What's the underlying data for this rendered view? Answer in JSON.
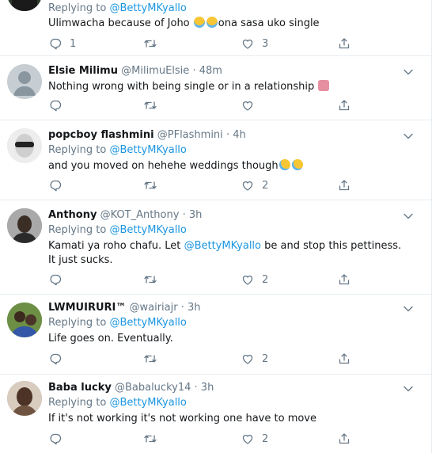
{
  "tweets": [
    {
      "name": "",
      "handle": "",
      "time": "",
      "replying_prefix": "Replying to",
      "replying_to": "@BettyMKyallo",
      "text_before": "Ulimwacha because of Joho",
      "text_after": "ona sasa uko single",
      "emojis": [
        "tears-of-joy",
        "tears-of-joy"
      ],
      "reply_count": "1",
      "retweet_count": "",
      "like_count": "3"
    },
    {
      "name": "Elsie Milimu",
      "handle": "@MilimuElsie",
      "time": "48m",
      "text_before": "Nothing wrong with being single or in a relationship",
      "emojis": [
        "woman-shrugging"
      ],
      "reply_count": "",
      "retweet_count": "",
      "like_count": ""
    },
    {
      "name": "popcboy flashmini",
      "handle": "@PFlashmini",
      "time": "4h",
      "replying_prefix": "Replying to",
      "replying_to": "@BettyMKyallo",
      "text_before": "and you moved on hehehe weddings though",
      "emojis": [
        "rolling-laughing",
        "rolling-laughing"
      ],
      "reply_count": "",
      "retweet_count": "",
      "like_count": "2"
    },
    {
      "name": "Anthony",
      "handle": "@KOT_Anthony",
      "time": "3h",
      "replying_prefix": "Replying to",
      "replying_to": "@BettyMKyallo",
      "text_before": "Kamati ya roho chafu. Let",
      "mention": "@BettyMKyallo",
      "text_after": "be and stop this pettiness. It just sucks.",
      "reply_count": "",
      "retweet_count": "",
      "like_count": "2"
    },
    {
      "name": "LWMUIRURI™",
      "handle": "@wairiajr",
      "time": "3h",
      "replying_prefix": "Replying to",
      "replying_to": "@BettyMKyallo",
      "text_before": "Life goes on. Eventually.",
      "reply_count": "",
      "retweet_count": "",
      "like_count": "2"
    },
    {
      "name": "Baba lucky",
      "handle": "@Babalucky14",
      "time": "3h",
      "replying_prefix": "Replying to",
      "replying_to": "@BettyMKyallo",
      "text_before": "If it's not working it's not working one have to move",
      "reply_count": "",
      "retweet_count": "",
      "like_count": "2"
    }
  ],
  "colors": {
    "link": "#1b95e0",
    "meta": "#657786",
    "text": "#14171a",
    "divider": "#e6ecf0"
  },
  "icons": [
    "reply-icon",
    "retweet-icon",
    "like-icon",
    "share-icon",
    "chevron-down-icon"
  ]
}
